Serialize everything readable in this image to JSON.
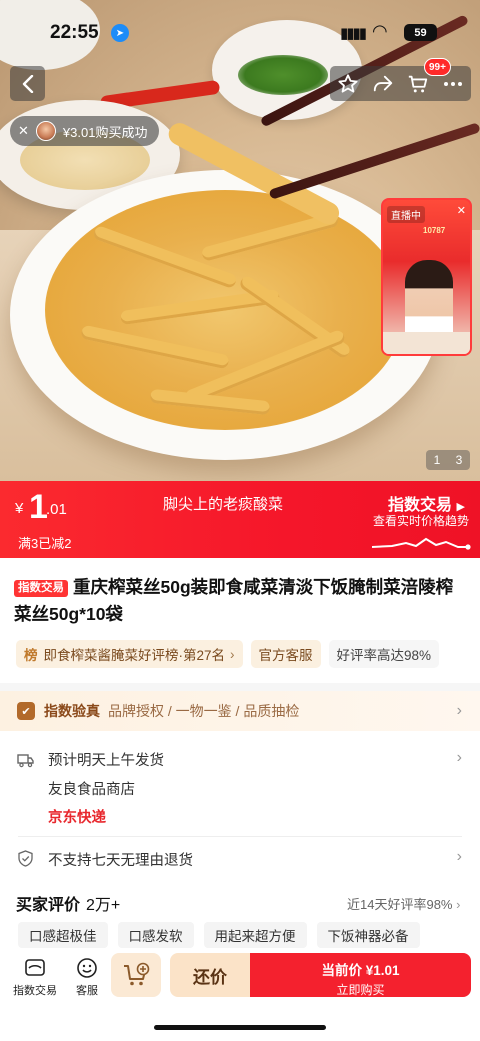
{
  "status_bar": {
    "time": "22:55",
    "battery": "59"
  },
  "hero": {
    "purchase_toast": "¥3.01购买成功",
    "cart_badge": "99+",
    "live": {
      "label": "直播中",
      "count": "10787"
    },
    "page_indicator": {
      "current": "1",
      "total": "3"
    }
  },
  "price_banner": {
    "currency": "¥",
    "price_int": "1",
    "price_dec": ".01",
    "promo": "满3已减2",
    "slogan": "脚尖上的老痰酸菜",
    "index_title": "指数交易",
    "index_sub": "查看实时价格趋势"
  },
  "product": {
    "tag": "指数交易",
    "title": "重庆榨菜丝50g装即食咸菜清淡下饭腌制菜涪陵榨菜丝50g*10袋"
  },
  "chips": {
    "rank_icon": "榜",
    "rank": "即食榨菜酱腌菜好评榜·第27名",
    "service": "官方客服",
    "rate": "好评率高达98%"
  },
  "verify": {
    "icon": "✔",
    "title": "指数验真",
    "desc": "品牌授权 / 一物一鉴 / 品质抽检"
  },
  "shipping": {
    "dispatch": "预计明天上午发货",
    "store": "友良食品商店",
    "express": "京东快递"
  },
  "returns": {
    "text": "不支持七天无理由退货"
  },
  "reviews": {
    "title": "买家评价",
    "count": "2万+",
    "rate": "近14天好评率98%",
    "tags": [
      "口感超极佳",
      "口感发软",
      "用起来超方便",
      "下饭神器必备"
    ]
  },
  "bottom_bar": {
    "index_trade": "指数交易",
    "service": "客服",
    "bargain": "还价",
    "buy_line1": "当前价 ¥1.01",
    "buy_line2": "立即购买"
  },
  "colors": {
    "brand_red": "#f4212e",
    "bargain_bg": "#fbe3c8",
    "verify_brown": "#8b4a1b"
  }
}
